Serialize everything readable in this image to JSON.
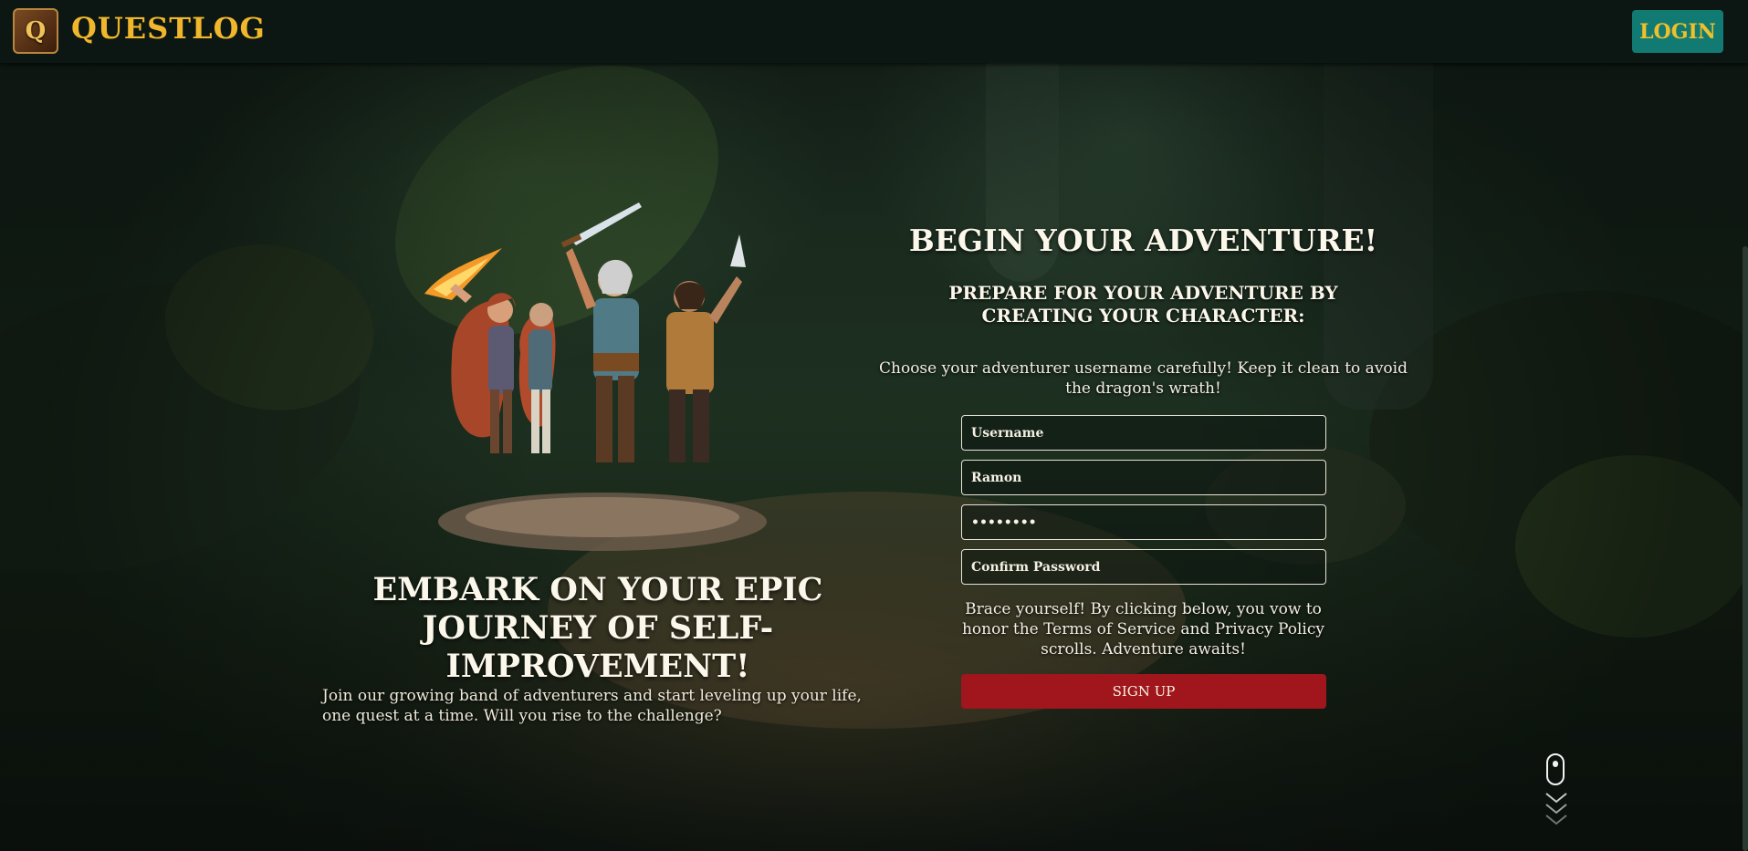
{
  "header": {
    "logo_letter": "Q",
    "brand": "QUESTLOG",
    "login_label": "LOGIN"
  },
  "hero": {
    "tagline": "EMBARK ON YOUR EPIC JOURNEY OF SELF-IMPROVEMENT!",
    "description": "Join our growing band of adventurers and start leveling up your life, one quest at a time. Will you rise to the challenge?"
  },
  "signup": {
    "title": "BEGIN YOUR ADVENTURE!",
    "subtitle": "PREPARE FOR YOUR ADVENTURE BY CREATING YOUR CHARACTER:",
    "note": "Choose your adventurer username carefully! Keep it clean to avoid the dragon's wrath!",
    "fields": {
      "username": {
        "value": "",
        "placeholder": "Username"
      },
      "name": {
        "value": "Ramon",
        "placeholder": ""
      },
      "password": {
        "value": "••••••••",
        "placeholder": ""
      },
      "confirm_password": {
        "value": "",
        "placeholder": "Confirm Password"
      }
    },
    "terms": "Brace yourself! By clicking below, you vow to honor the Terms of Service and Privacy Policy scrolls. Adventure awaits!",
    "button_label": "SIGN UP"
  },
  "colors": {
    "brand_gold": "#f0b72c",
    "login_teal": "#117a72",
    "signup_red": "#a0161c",
    "header_bg": "#0c1613"
  },
  "icons": {
    "logo": "spellbook-icon",
    "scroll_hint": "mouse-scroll-icon",
    "scroll_arrows": "chevron-down-icon"
  }
}
